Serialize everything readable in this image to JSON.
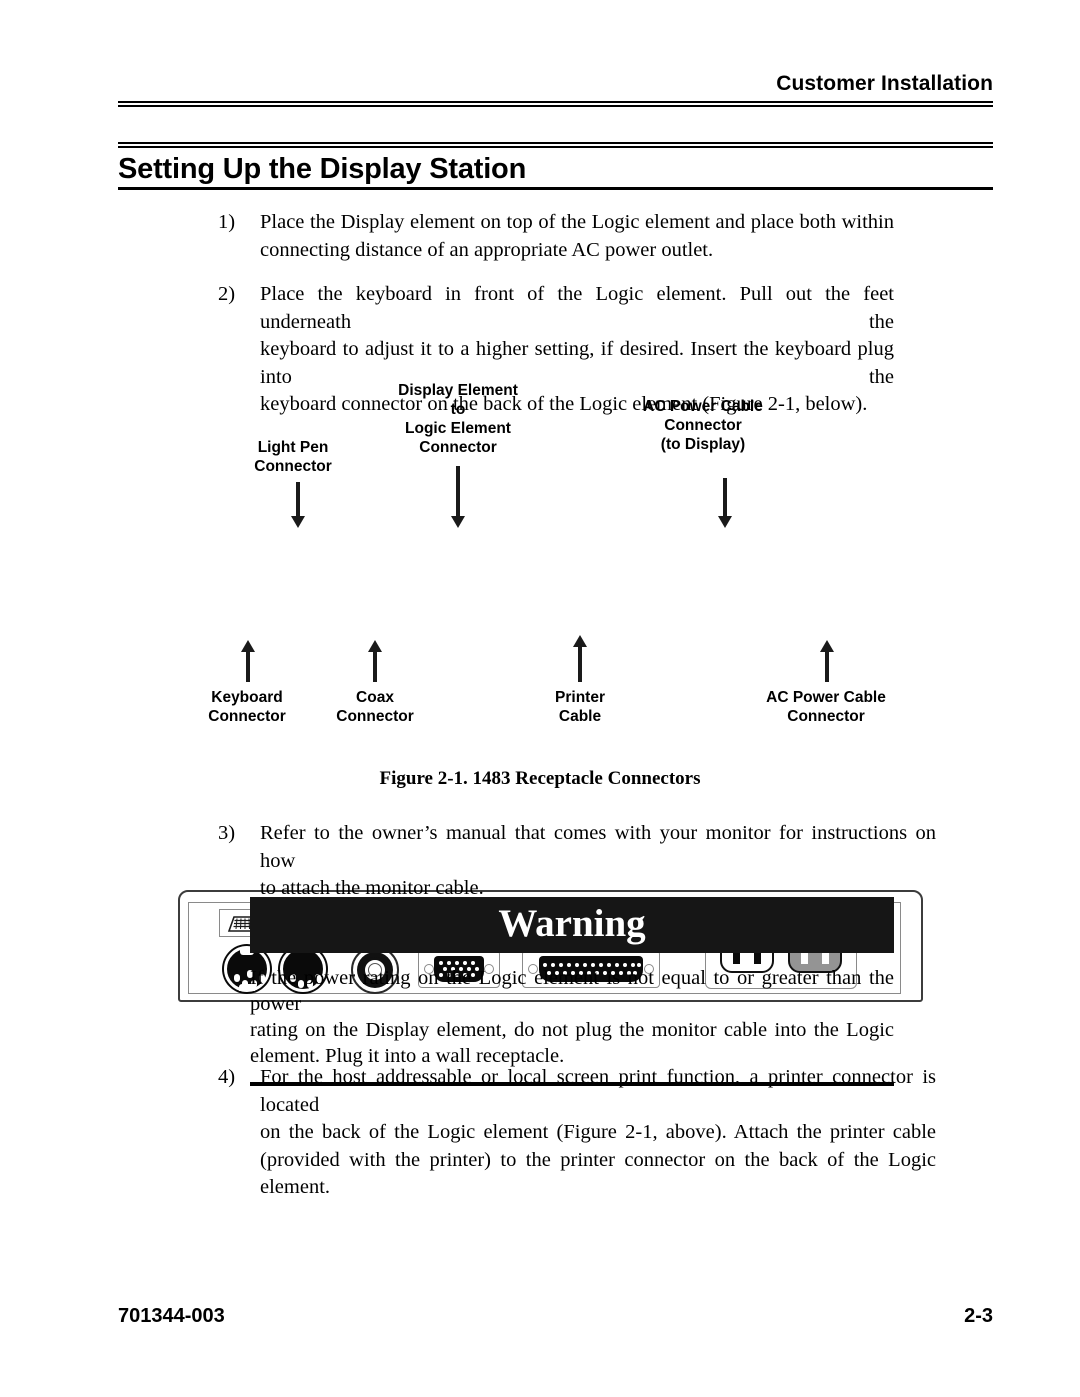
{
  "header": {
    "running_title": "Customer Installation"
  },
  "title": "Setting Up the Display Station",
  "steps": [
    {
      "number": "1)",
      "lines": [
        "Place the Display element on top of the Logic element and place both within",
        "connecting distance of an appropriate AC power outlet."
      ]
    },
    {
      "number": "2)",
      "lines": [
        "Place the keyboard in front of the Logic element. Pull out the feet underneath the",
        "keyboard to adjust it to a higher setting, if desired. Insert the keyboard plug into the",
        "keyboard connector on the back of the Logic element (Figure 2-1, below)."
      ]
    },
    {
      "number": "3)",
      "lines": [
        "Refer to the owner’s manual that comes with your monitor for instructions on how",
        "to attach the monitor cable."
      ]
    },
    {
      "number": "4)",
      "lines": [
        "For the host addressable or local screen print function, a printer connector is located",
        "on the back of the Logic element (Figure 2-1, above). Attach the printer cable",
        "(provided with the printer) to the printer connector on the back of the Logic element."
      ]
    }
  ],
  "figure": {
    "caption": "Figure 2-1.  1483 Receptacle Connectors",
    "top_labels": [
      {
        "text": "Light Pen\nConnector"
      },
      {
        "text": "Display Element\nto\nLogic Element\nConnector"
      },
      {
        "text": "AC Power Cable\nConnector\n(to Display)"
      }
    ],
    "bottom_labels": [
      {
        "text": "Keyboard\nConnector"
      },
      {
        "text": "Coax\nConnector"
      },
      {
        "text": "Printer\nCable"
      },
      {
        "text": "AC Power Cable\nConnector"
      }
    ],
    "panel_icons": [
      "keyboard-icon",
      "light-pen-icon",
      "coax-icon",
      "monitor-icon",
      "printer-icon"
    ],
    "colors": {
      "panel_border": "#3c3c3c",
      "inner_border": "#8a8a8a",
      "connector_fill": "#0a0a0a",
      "outlet_gray": "#949494"
    }
  },
  "warning": {
    "heading": "Warning",
    "lines": [
      "If the power rating on the Logic element is not equal to or greater than the power",
      "rating on the Display element, do not plug the monitor cable into the Logic",
      "element. Plug it into a wall receptacle."
    ]
  },
  "footer": {
    "document_number": "701344-003",
    "page_number": "2-3"
  }
}
